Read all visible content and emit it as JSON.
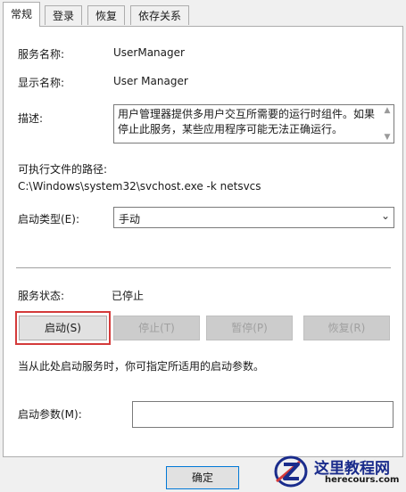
{
  "tabs": [
    "常规",
    "登录",
    "恢复",
    "依存关系"
  ],
  "general": {
    "service_name_label": "服务名称:",
    "service_name": "UserManager",
    "display_name_label": "显示名称:",
    "display_name": "User Manager",
    "description_label": "描述:",
    "description": "用户管理器提供多用户交互所需要的运行时组件。如果停止此服务，某些应用程序可能无法正确运行。",
    "path_label": "可执行文件的路径:",
    "path": "C:\\Windows\\system32\\svchost.exe -k netsvcs",
    "startup_type_label": "启动类型(E):",
    "startup_type": "手动",
    "status_label": "服务状态:",
    "status": "已停止",
    "buttons": {
      "start": "启动(S)",
      "stop": "停止(T)",
      "pause": "暂停(P)",
      "resume": "恢复(R)"
    },
    "hint": "当从此处启动服务时，你可指定所适用的启动参数。",
    "params_label": "启动参数(M):",
    "params_value": ""
  },
  "footer": {
    "ok": "确定"
  },
  "watermark": {
    "title": "这里教程网",
    "url": "herecours.com"
  },
  "colors": {
    "highlight": "#d43a3a",
    "logo": "#1a2c8c",
    "focus": "#0078d7"
  }
}
